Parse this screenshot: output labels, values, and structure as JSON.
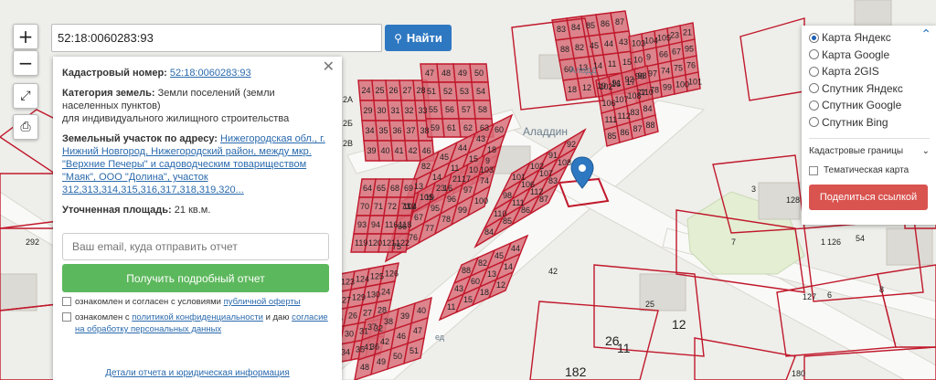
{
  "search": {
    "value": "52:18:0060283:93",
    "button_label": "Найти"
  },
  "controls": {
    "zoom_in": "+",
    "zoom_out": "−"
  },
  "info": {
    "cad_label": "Кадастровый номер:",
    "cad_value": "52:18:0060283:93",
    "cat_label": "Категория земель:",
    "cat_value": "Земли поселений (земли населенных пунктов)",
    "cat_use": "для индивидуального жилищного строительства",
    "addr_label": "Земельный участок по адресу:",
    "addr_value": "Нижегородская обл., г. Нижний Новгород, Нижегородский район, между мкр. \"Верхние Печеры\" и садоводческим товариществом \"Маяк\", ООО \"Долина\", участок 312,313,314,315,316,317,318,319,320...",
    "area_label": "Уточненная площадь:",
    "area_value": "21 кв.м.",
    "email_placeholder": "Ваш email, куда отправить отчет",
    "report_button": "Получить подробный отчет",
    "agree1_text": "ознакомлен и согласен с условиями",
    "agree1_link": "публичной оферты",
    "agree2_text": "ознакомлен с",
    "agree2_link": "политикой конфиденциальности",
    "agree2_text2": "и даю",
    "agree2_link2": "согласие на обработку персональных данных",
    "details_link": "Детали отчета и юридическая информация"
  },
  "layers": {
    "options": [
      "Карта Яндекс",
      "Карта Google",
      "Карта 2GIS",
      "Спутник Яндекс",
      "Спутник Google",
      "Спутник Bing"
    ],
    "selected_index": 0,
    "select_value": "Кадастровые границы",
    "thematic_label": "Тематическая карта",
    "share_button": "Поделиться ссылкой"
  },
  "map": {
    "place_label": "Аладдин",
    "place_label2": "Аладд",
    "street_label": "ед",
    "parcel_numbers_a": [
      "83",
      "84",
      "85",
      "86",
      "87",
      "88",
      "82",
      "45",
      "44",
      "43",
      "60",
      "13",
      "14",
      "11",
      "15",
      "18",
      "12",
      "19",
      "16",
      "17",
      "103",
      "104",
      "105",
      "23",
      "21",
      "10",
      "9",
      "66",
      "67",
      "95",
      "96",
      "97",
      "74",
      "75",
      "76",
      "77",
      "78",
      "99",
      "100",
      "101",
      "102",
      "91",
      "92",
      "98",
      "106",
      "107",
      "108",
      "110",
      "111",
      "112"
    ],
    "parcel_numbers_b": [
      "24",
      "25",
      "26",
      "27",
      "28",
      "29",
      "30",
      "31",
      "32",
      "33",
      "34",
      "35",
      "36",
      "37",
      "38",
      "39",
      "40",
      "41",
      "42",
      "46",
      "47",
      "48",
      "49",
      "50",
      "51",
      "52",
      "53",
      "54",
      "55",
      "56",
      "57",
      "58",
      "59",
      "61",
      "62",
      "63",
      "64",
      "65",
      "68",
      "69",
      "70",
      "71",
      "72",
      "73",
      "93",
      "94",
      "116",
      "118",
      "119",
      "120",
      "121",
      "122",
      "123",
      "124",
      "125",
      "126",
      "127",
      "129",
      "130"
    ],
    "labels_big": [
      "2А",
      "2Б",
      "2В",
      "292",
      "3",
      "128",
      "7",
      "126",
      "127",
      "25",
      "12",
      "26",
      "11",
      "182",
      "180",
      "54",
      "1",
      "6",
      "8",
      "42"
    ],
    "accent": "#d8707a",
    "border": "#c0182b"
  }
}
